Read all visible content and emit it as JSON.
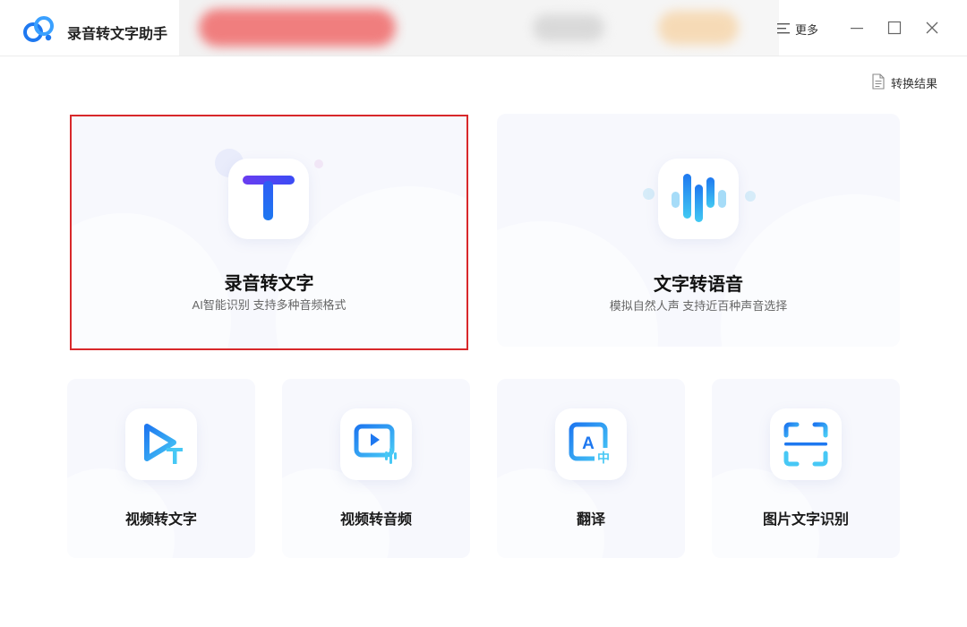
{
  "app": {
    "title": "录音转文字助手"
  },
  "header": {
    "more_label": "更多"
  },
  "toolbar": {
    "result_label": "转换结果"
  },
  "features_main": [
    {
      "title": "录音转文字",
      "desc": "AI智能识别 支持多种音频格式",
      "selected": true
    },
    {
      "title": "文字转语音",
      "desc": "模拟自然人声 支持近百种声音选择",
      "selected": false
    }
  ],
  "features_small": [
    {
      "title": "视频转文字"
    },
    {
      "title": "视频转音频"
    },
    {
      "title": "翻译"
    },
    {
      "title": "图片文字识别"
    }
  ],
  "colors": {
    "accent_blue": "#1e78f0",
    "accent_purple": "#6a3cf0",
    "selection_border": "#d8282b",
    "card_bg": "#f7f8fd"
  },
  "icons": {
    "logo": "app-logo",
    "more": "menu-lines-icon",
    "minimize": "minimize-icon",
    "maximize": "maximize-icon",
    "close": "close-icon",
    "result": "document-icon",
    "main": [
      "text-t-icon",
      "sound-wave-icon"
    ],
    "small": [
      "video-text-icon",
      "video-audio-icon",
      "translate-icon",
      "scan-icon"
    ]
  }
}
